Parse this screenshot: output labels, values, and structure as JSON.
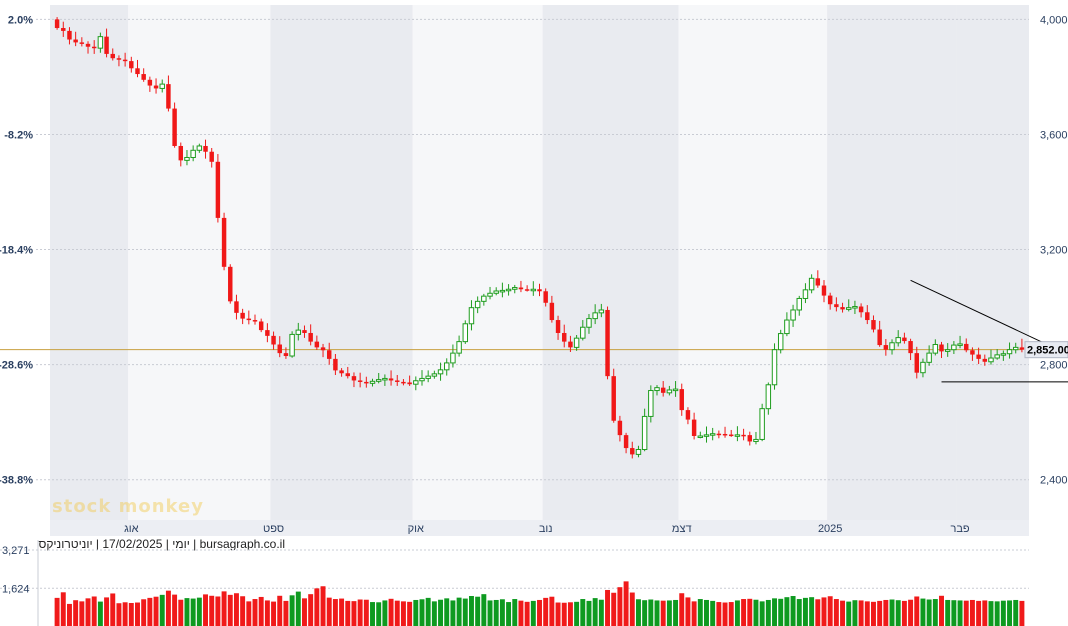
{
  "chart_data": {
    "type": "candlestick",
    "colors": {
      "up": "#1f9d1f",
      "down": "#f01818",
      "volume_up": "#0e9a20",
      "volume_down": "#f01a1a",
      "reference_line": "#c8a040"
    },
    "left_axis_labels": [
      "2.0%",
      "-8.2%",
      "-18.4%",
      "-28.6%",
      "-38.8%"
    ],
    "right_axis_labels": [
      "4,000",
      "3,600",
      "3,200",
      "2,800",
      "2,400"
    ],
    "right_ticks": [
      4000,
      3600,
      3200,
      2800,
      2400
    ],
    "ylim": [
      2260,
      4050
    ],
    "last_price_label": "2,852.00",
    "last_price": 2852,
    "months": [
      {
        "label": "אוג",
        "index": 12
      },
      {
        "label": "ספט",
        "index": 35
      },
      {
        "label": "אוק",
        "index": 58
      },
      {
        "label": "נוב",
        "index": 79
      },
      {
        "label": "דצמ",
        "index": 101
      },
      {
        "label": "2025",
        "index": 125
      },
      {
        "label": "פבר",
        "index": 146
      }
    ],
    "shaded_months": [
      1,
      3,
      5
    ],
    "volume_labels": [
      "3,271",
      "1,624"
    ],
    "volume_ticks": [
      3271,
      1624
    ],
    "volume_max": 3700,
    "closes": [
      3970,
      3960,
      3930,
      3920,
      3915,
      3905,
      3900,
      3940,
      3880,
      3865,
      3860,
      3855,
      3830,
      3810,
      3790,
      3770,
      3760,
      3775,
      3690,
      3560,
      3510,
      3520,
      3545,
      3560,
      3540,
      3505,
      3310,
      3140,
      3020,
      2980,
      2960,
      2955,
      2950,
      2920,
      2900,
      2870,
      2840,
      2830,
      2905,
      2920,
      2910,
      2880,
      2860,
      2850,
      2820,
      2780,
      2770,
      2760,
      2745,
      2740,
      2735,
      2742,
      2748,
      2752,
      2745,
      2740,
      2738,
      2732,
      2744,
      2752,
      2760,
      2768,
      2782,
      2806,
      2840,
      2880,
      2942,
      2998,
      3020,
      3038,
      3048,
      3056,
      3058,
      3062,
      3068,
      3062,
      3060,
      3062,
      3055,
      3015,
      2955,
      2910,
      2880,
      2860,
      2892,
      2930,
      2960,
      2980,
      2990,
      2760,
      2605,
      2555,
      2510,
      2488,
      2505,
      2620,
      2710,
      2720,
      2702,
      2712,
      2715,
      2642,
      2609,
      2552,
      2552,
      2556,
      2560,
      2559,
      2557,
      2556,
      2556,
      2555,
      2533,
      2540,
      2647,
      2730,
      2852,
      2908,
      2955,
      2990,
      3030,
      3060,
      3100,
      3075,
      3040,
      3010,
      3000,
      2992,
      2998,
      3002,
      2982,
      2955,
      2922,
      2868,
      2852,
      2876,
      2894,
      2882,
      2840,
      2772,
      2808,
      2840,
      2870,
      2846,
      2852,
      2868,
      2872,
      2850,
      2835,
      2820,
      2810,
      2823,
      2834,
      2838,
      2852,
      2860,
      2852
    ],
    "volumes": [
      1210,
      1450,
      950,
      1110,
      1060,
      1190,
      1270,
      1050,
      1230,
      1400,
      980,
      1020,
      990,
      1010,
      1150,
      1210,
      1260,
      1340,
      1520,
      1350,
      1130,
      1200,
      1180,
      1220,
      1360,
      1300,
      1270,
      1490,
      1340,
      1410,
      1280,
      1060,
      1160,
      1250,
      1100,
      1050,
      1300,
      1080,
      1320,
      1480,
      1190,
      1370,
      1620,
      1710,
      1220,
      1160,
      1180,
      1080,
      1070,
      1140,
      1130,
      1030,
      1020,
      1100,
      1170,
      1090,
      1060,
      1040,
      1120,
      1150,
      1210,
      1060,
      1130,
      1190,
      1100,
      1220,
      1180,
      1290,
      1260,
      1370,
      1100,
      1120,
      1150,
      1030,
      1160,
      1090,
      1040,
      1080,
      1120,
      1210,
      1260,
      1010,
      1000,
      1020,
      1040,
      1160,
      1080,
      1200,
      1130,
      1550,
      1430,
      1670,
      1920,
      1440,
      1150,
      1110,
      1140,
      1100,
      1090,
      1100,
      1120,
      1410,
      1230,
      1060,
      1160,
      1120,
      1080,
      1030,
      1010,
      1030,
      1100,
      1160,
      1170,
      1130,
      1060,
      1120,
      1190,
      1170,
      1240,
      1290,
      1160,
      1210,
      1240,
      1150,
      1230,
      1280,
      1160,
      1090,
      1050,
      1110,
      1100,
      1060,
      1040,
      1080,
      1120,
      1140,
      1110,
      1080,
      1130,
      1270,
      1180,
      1140,
      1160,
      1300,
      1120,
      1110,
      1100,
      1090,
      1120,
      1080,
      1100,
      1070,
      1060,
      1090,
      1100,
      1120,
      1080
    ],
    "annotations": {
      "trendline_upper": [
        [
          138,
          3093
        ],
        [
          168,
          2790
        ]
      ],
      "trendline_lower": [
        [
          143,
          2740
        ],
        [
          168,
          2740
        ]
      ]
    }
  },
  "watermark": "stock monkey",
  "info_line": "יומי | 17/02/2025 | יוניטרוניקס | bursagraph.co.il"
}
